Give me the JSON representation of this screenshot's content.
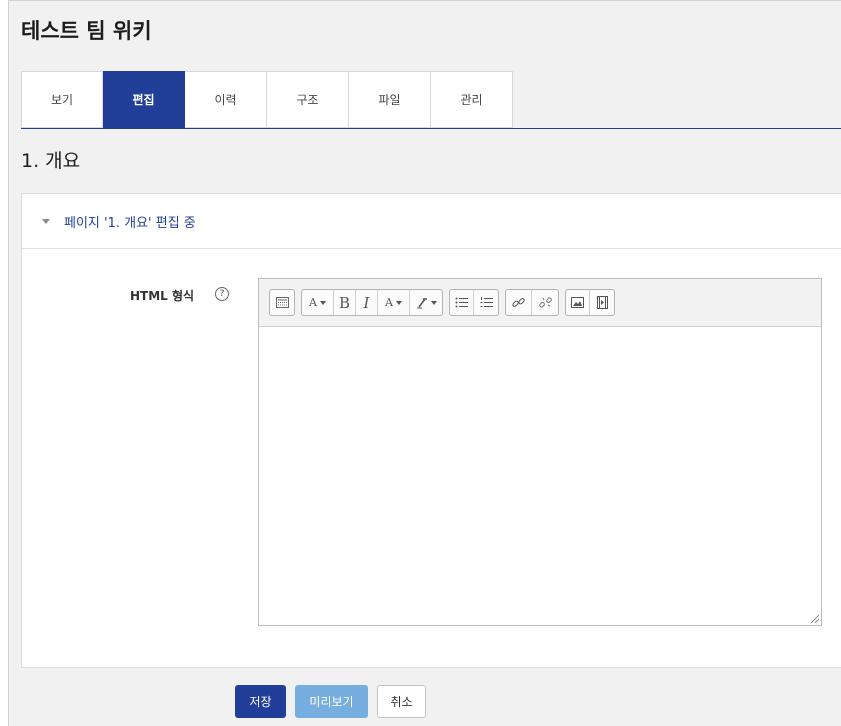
{
  "wiki": {
    "title": "테스트 팀 위키"
  },
  "tabs": [
    {
      "label": "보기"
    },
    {
      "label": "편집"
    },
    {
      "label": "이력"
    },
    {
      "label": "구조"
    },
    {
      "label": "파일"
    },
    {
      "label": "관리"
    }
  ],
  "active_tab": "편집",
  "page": {
    "section_title": "1. 개요"
  },
  "form": {
    "header": "페이지 '1. 개요' 편집 중",
    "field_label": "HTML 형식",
    "help_icon": "?"
  },
  "toolbar": {
    "buttons": [
      {
        "icon": "show-more-icon"
      },
      {
        "icon": "font-style-icon",
        "label": "A"
      },
      {
        "icon": "bold-icon",
        "label": "B"
      },
      {
        "icon": "italic-icon",
        "label": "I"
      },
      {
        "icon": "text-color-icon",
        "label": "A"
      },
      {
        "icon": "clear-format-icon"
      },
      {
        "icon": "unordered-list-icon"
      },
      {
        "icon": "ordered-list-icon"
      },
      {
        "icon": "link-icon"
      },
      {
        "icon": "unlink-icon"
      },
      {
        "icon": "image-icon"
      },
      {
        "icon": "media-icon"
      }
    ]
  },
  "actions": {
    "save": "저장",
    "preview": "미리보기",
    "cancel": "취소"
  },
  "colors": {
    "primary": "#213f99",
    "preview": "#77aee0",
    "background": "#f1f1f1"
  }
}
